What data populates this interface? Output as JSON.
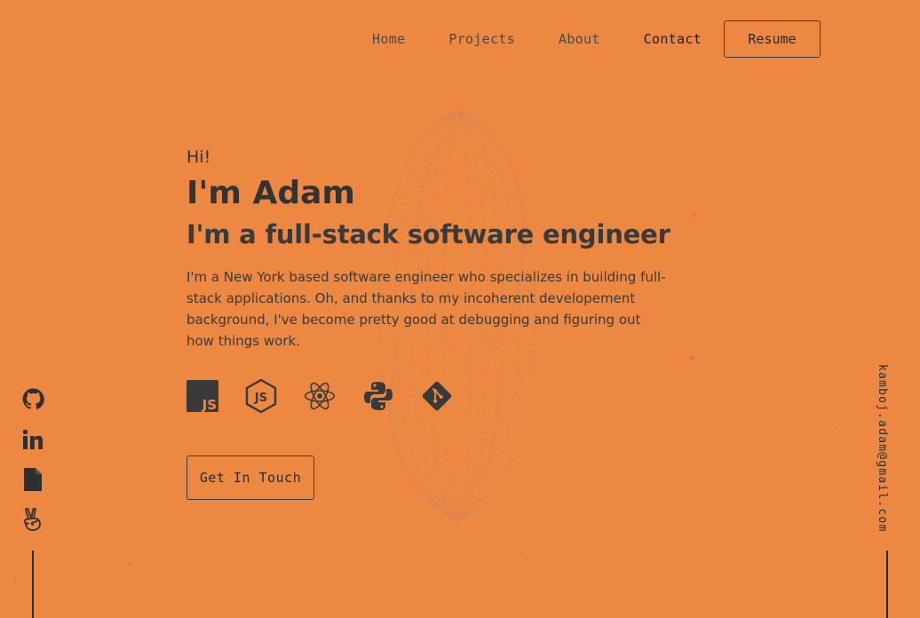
{
  "nav": {
    "items": [
      {
        "label": "Home",
        "active": false
      },
      {
        "label": "Projects",
        "active": false
      },
      {
        "label": "About",
        "active": false
      },
      {
        "label": "Contact",
        "active": true
      }
    ],
    "resume_label": "Resume"
  },
  "hero": {
    "greeting": "Hi!",
    "name": "I'm Adam",
    "role": "I'm a full-stack software engineer",
    "description": "I'm a New York based software engineer who specializes in building full-stack applications. Oh, and thanks to my incoherent developement background, I've become pretty good at debugging and figuring out how things work.",
    "cta_label": "Get In Touch"
  },
  "tech_icons": [
    "javascript-icon",
    "nodejs-icon",
    "react-icon",
    "python-icon",
    "git-icon"
  ],
  "socials": [
    "github-icon",
    "linkedin-icon",
    "document-icon",
    "angellist-icon"
  ],
  "email": "kamboj.adam@gmail.com",
  "colors": {
    "background": "#ec8842",
    "text": "#333333",
    "accent_dark": "#2c2c2c"
  }
}
